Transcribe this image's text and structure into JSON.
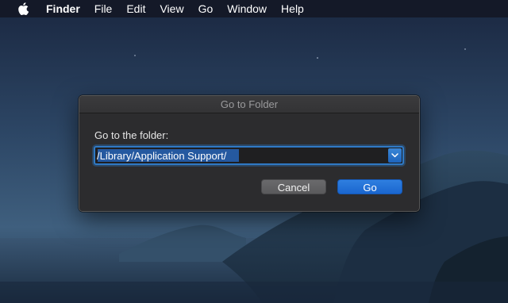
{
  "menubar": {
    "apple_icon": "apple-icon",
    "app_name": "Finder",
    "items": [
      "File",
      "Edit",
      "View",
      "Go",
      "Window",
      "Help"
    ]
  },
  "dialog": {
    "title": "Go to Folder",
    "prompt": "Go to the folder:",
    "path_value": "/Library/Application Support/",
    "dropdown_icon": "chevron-down-icon",
    "cancel_label": "Cancel",
    "go_label": "Go"
  },
  "colors": {
    "accent": "#1a66cf",
    "dialog_bg": "#2c2c2e",
    "menubar_bg": "#141826"
  }
}
